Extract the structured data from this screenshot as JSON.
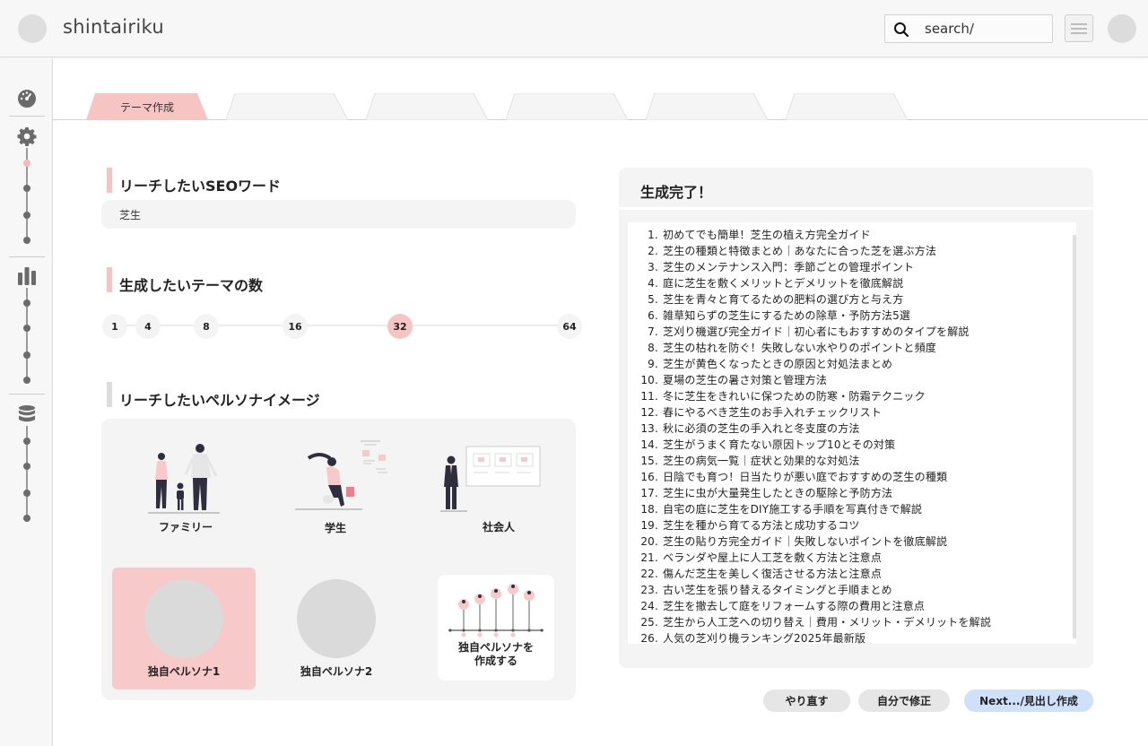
{
  "header": {
    "brand": "shintairiku",
    "search_value": "search/"
  },
  "tabs": [
    {
      "label": "テーマ作成",
      "active": true
    },
    {
      "label": "",
      "active": false
    },
    {
      "label": "",
      "active": false
    },
    {
      "label": "",
      "active": false
    },
    {
      "label": "",
      "active": false
    },
    {
      "label": "",
      "active": false
    }
  ],
  "seo": {
    "title": "リーチしたいSEOワード",
    "value": "芝生"
  },
  "theme_count": {
    "title": "生成したいテーマの数",
    "options": [
      "1",
      "4",
      "8",
      "16",
      "32",
      "64"
    ],
    "selected": "32"
  },
  "persona": {
    "title": "リーチしたいペルソナイメージ",
    "items": {
      "family": "ファミリー",
      "student": "学生",
      "worker": "社会人",
      "custom1": "独自ペルソナ1",
      "custom2": "独自ペルソナ2",
      "create": "独自ペルソナを\n作成する"
    },
    "selected": "独自ペルソナ1"
  },
  "result": {
    "title": "生成完了！",
    "items": [
      "初めてでも簡単！芝生の植え方完全ガイド",
      "芝生の種類と特徴まとめ｜あなたに合った芝を選ぶ方法",
      "芝生のメンテナンス入門：季節ごとの管理ポイント",
      "庭に芝生を敷くメリットとデメリットを徹底解説",
      "芝生を青々と育てるための肥料の選び方と与え方",
      "雑草知らずの芝生にするための除草・予防方法5選",
      "芝刈り機選び完全ガイド｜初心者にもおすすめのタイプを解説",
      "芝生の枯れを防ぐ！失敗しない水やりのポイントと頻度",
      "芝生が黄色くなったときの原因と対処法まとめ",
      "夏場の芝生の暑さ対策と管理方法",
      "冬に芝生をきれいに保つための防寒・防霜テクニック",
      "春にやるべき芝生のお手入れチェックリスト",
      "秋に必須の芝生の手入れと冬支度の方法",
      "芝生がうまく育たない原因トップ10とその対策",
      "芝生の病気一覧｜症状と効果的な対処法",
      "日陰でも育つ！日当たりが悪い庭でおすすめの芝生の種類",
      "芝生に虫が大量発生したときの駆除と予防方法",
      "自宅の庭に芝生をDIY施工する手順を写真付きで解説",
      "芝生を種から育てる方法と成功するコツ",
      "芝生の貼り方完全ガイド｜失敗しないポイントを徹底解説",
      "ベランダや屋上に人工芝を敷く方法と注意点",
      "傷んだ芝生を美しく復活させる方法と注意点",
      "古い芝生を張り替えるタイミングと手順まとめ",
      "芝生を撤去して庭をリフォームする際の費用と注意点",
      "芝生から人工芝への切り替え｜費用・メリット・デメリットを解説",
      "人気の芝刈り機ランキング2025年最新版"
    ]
  },
  "buttons": {
    "redo": "やり直す",
    "edit": "自分で修正",
    "next": "Next.../見出し作成"
  },
  "colors": {
    "accent_pink": "#f7c4c4",
    "next_blue": "#cfe0fb",
    "panel_gray": "#f4f4f4"
  }
}
